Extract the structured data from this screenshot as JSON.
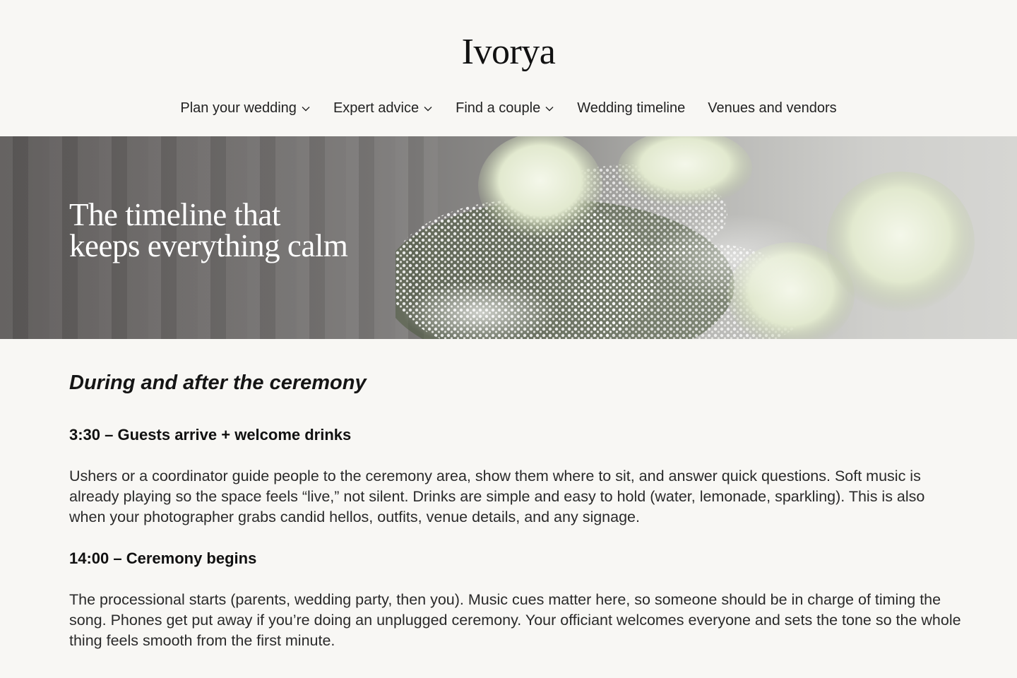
{
  "header": {
    "logo": "Ivorya"
  },
  "nav": {
    "items": [
      {
        "label": "Plan your wedding",
        "has_dropdown": true
      },
      {
        "label": "Expert advice",
        "has_dropdown": true
      },
      {
        "label": "Find a couple",
        "has_dropdown": true
      },
      {
        "label": "Wedding timeline",
        "has_dropdown": false
      },
      {
        "label": "Venues and vendors",
        "has_dropdown": false
      }
    ]
  },
  "hero": {
    "title_line1": "The timeline that",
    "title_line2": "keeps everything calm",
    "image": "white-hydrangea-and-babys-breath-bouquet"
  },
  "main": {
    "section_title": "During and after the ceremony",
    "entries": [
      {
        "time_heading": "3:30 – Guests arrive + welcome drinks",
        "text": "Ushers or a coordinator guide people to the ceremony area, show them where to sit, and answer quick questions. Soft music is already playing so the space feels “live,” not silent. Drinks are simple and easy to hold (water, lemonade, sparkling). This is also when your photographer grabs candid hellos, outfits, venue details, and any signage."
      },
      {
        "time_heading": "14:00 – Ceremony begins",
        "text": "The processional starts (parents, wedding party, then you). Music cues matter here, so someone should be in charge of timing the song. Phones get put away if you’re doing an unplugged ceremony. Your officiant welcomes everyone and sets the tone so the whole thing feels smooth from the first minute."
      }
    ]
  },
  "colors": {
    "background": "#f8f7f4",
    "text": "#1c1c1c",
    "hero_text": "#ffffff"
  }
}
